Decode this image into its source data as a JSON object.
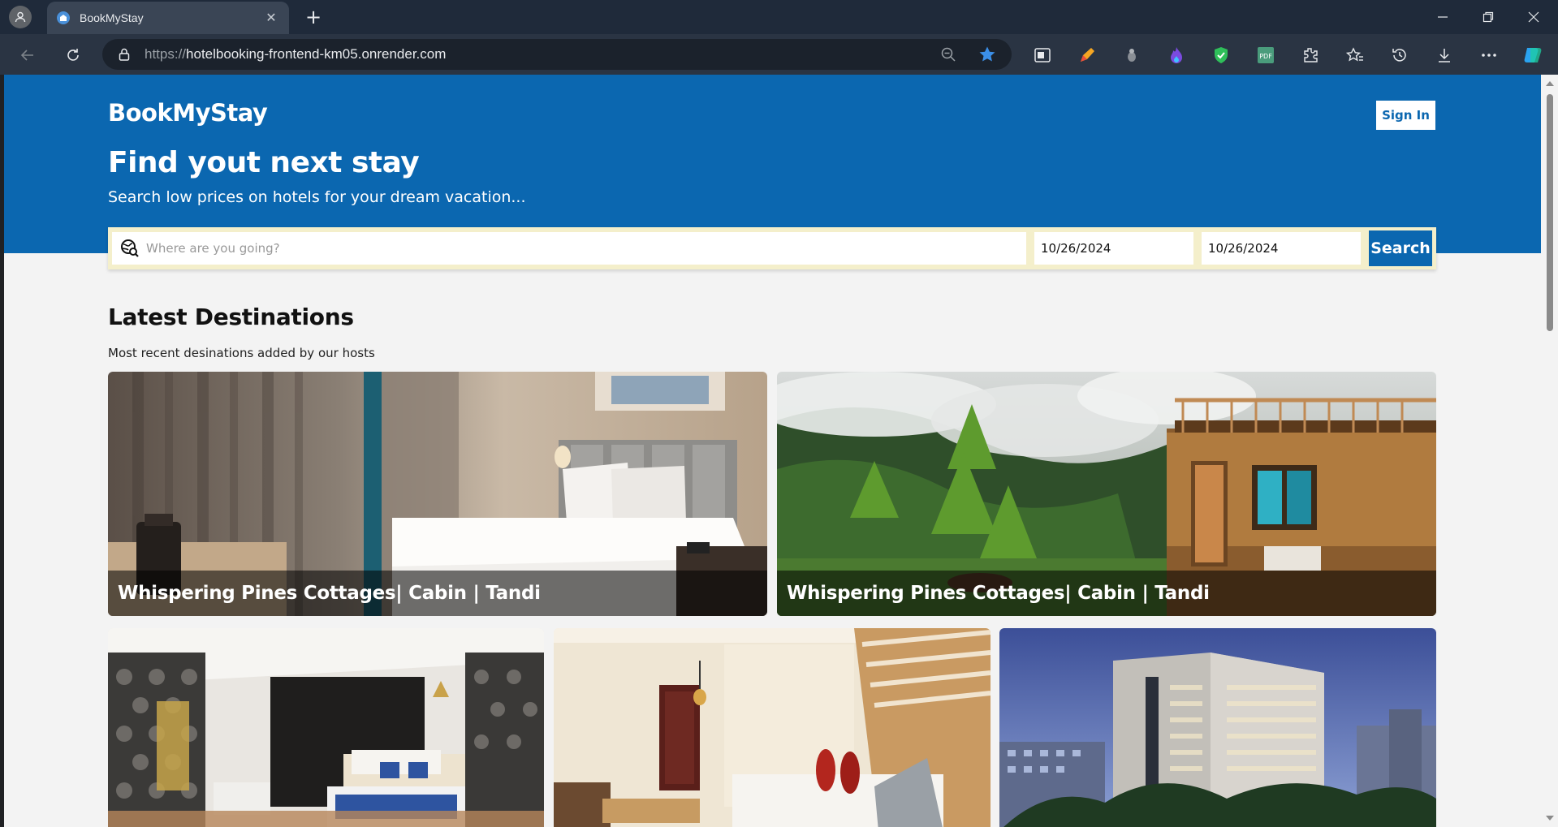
{
  "browser": {
    "tab_title": "BookMyStay",
    "url_protocol": "https://",
    "url_host": "hotelbooking-frontend-km05.onrender.com"
  },
  "header": {
    "brand": "BookMyStay",
    "signin_label": "Sign In",
    "hero_title": "Find yout next stay",
    "hero_subtitle": "Search low prices on hotels for your dream vacation..."
  },
  "search": {
    "destination_placeholder": "Where are you going?",
    "checkin_date": "10/26/2024",
    "checkout_date": "10/26/2024",
    "button_label": "Search"
  },
  "destinations": {
    "title": "Latest Destinations",
    "subtitle": "Most recent desinations added by our hosts",
    "cards": [
      {
        "name": "Whispering Pines Cottages| Cabin | Tandi"
      },
      {
        "name": "Whispering Pines Cottages| Cabin | Tandi"
      }
    ]
  },
  "colors": {
    "brand_blue": "#0b67b0",
    "search_bar": "#f4efcb",
    "page_bg": "#f3f3f3"
  }
}
